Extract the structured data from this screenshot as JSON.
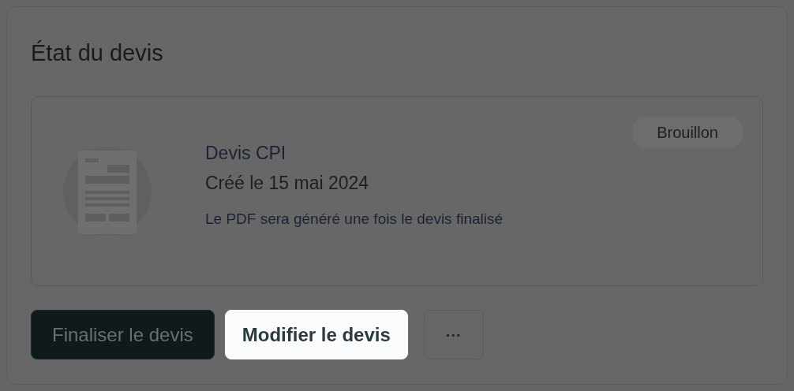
{
  "panel": {
    "title": "État du devis"
  },
  "quote": {
    "name": "Devis CPI",
    "created": "Créé le 15 mai 2024",
    "note": "Le PDF sera généré une fois le devis finalisé",
    "status": "Brouillon"
  },
  "buttons": [
    {
      "kind": "primary",
      "label": "Finaliser le devis",
      "highlighted": false
    },
    {
      "kind": "secondary",
      "label": "Modifier le devis",
      "highlighted": true
    },
    {
      "kind": "more",
      "label": "···",
      "highlighted": false
    }
  ]
}
